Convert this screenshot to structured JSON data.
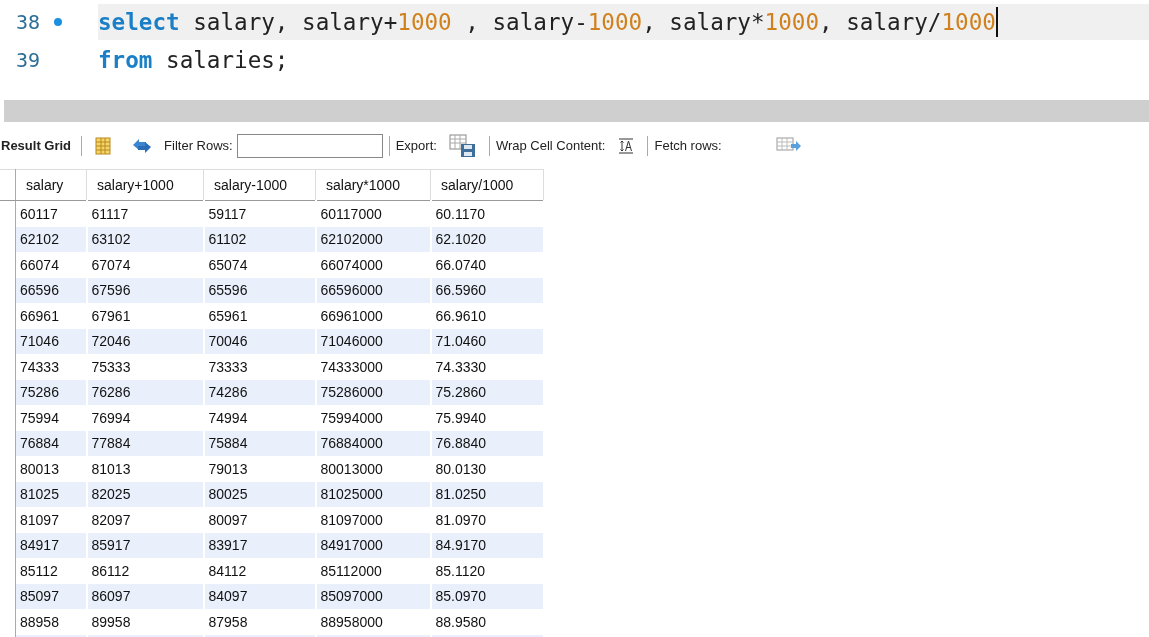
{
  "editor": {
    "lines": [
      {
        "number": "38",
        "breakpoint": true,
        "current": true,
        "tokens": [
          {
            "kind": "keyword",
            "text": "select"
          },
          {
            "kind": "plain",
            "text": " salary, salary+"
          },
          {
            "kind": "number",
            "text": "1000"
          },
          {
            "kind": "plain",
            "text": " , salary-"
          },
          {
            "kind": "number",
            "text": "1000"
          },
          {
            "kind": "plain",
            "text": ", salary*"
          },
          {
            "kind": "number",
            "text": "1000"
          },
          {
            "kind": "plain",
            "text": ", salary/"
          },
          {
            "kind": "number",
            "text": "1000"
          }
        ]
      },
      {
        "number": "39",
        "breakpoint": false,
        "current": false,
        "tokens": [
          {
            "kind": "keyword",
            "text": "from"
          },
          {
            "kind": "plain",
            "text": " salaries;"
          }
        ]
      }
    ]
  },
  "toolbar": {
    "result_grid": "Result Grid",
    "filter_label": "Filter Rows:",
    "export_label": "Export:",
    "wrap_label": "Wrap Cell Content:",
    "fetch_label": "Fetch rows:"
  },
  "table": {
    "columns": [
      "salary",
      "salary+1000",
      "salary-1000",
      "salary*1000",
      "salary/1000"
    ],
    "rows": [
      [
        "60117",
        "61117",
        "59117",
        "60117000",
        "60.1170"
      ],
      [
        "62102",
        "63102",
        "61102",
        "62102000",
        "62.1020"
      ],
      [
        "66074",
        "67074",
        "65074",
        "66074000",
        "66.0740"
      ],
      [
        "66596",
        "67596",
        "65596",
        "66596000",
        "66.5960"
      ],
      [
        "66961",
        "67961",
        "65961",
        "66961000",
        "66.9610"
      ],
      [
        "71046",
        "72046",
        "70046",
        "71046000",
        "71.0460"
      ],
      [
        "74333",
        "75333",
        "73333",
        "74333000",
        "74.3330"
      ],
      [
        "75286",
        "76286",
        "74286",
        "75286000",
        "75.2860"
      ],
      [
        "75994",
        "76994",
        "74994",
        "75994000",
        "75.9940"
      ],
      [
        "76884",
        "77884",
        "75884",
        "76884000",
        "76.8840"
      ],
      [
        "80013",
        "81013",
        "79013",
        "80013000",
        "80.0130"
      ],
      [
        "81025",
        "82025",
        "80025",
        "81025000",
        "81.0250"
      ],
      [
        "81097",
        "82097",
        "80097",
        "81097000",
        "81.0970"
      ],
      [
        "84917",
        "85917",
        "83917",
        "84917000",
        "84.9170"
      ],
      [
        "85112",
        "86112",
        "84112",
        "85112000",
        "85.1120"
      ],
      [
        "85097",
        "86097",
        "84097",
        "85097000",
        "85.0970"
      ],
      [
        "88958",
        "89958",
        "87958",
        "88958000",
        "88.9580"
      ]
    ]
  }
}
